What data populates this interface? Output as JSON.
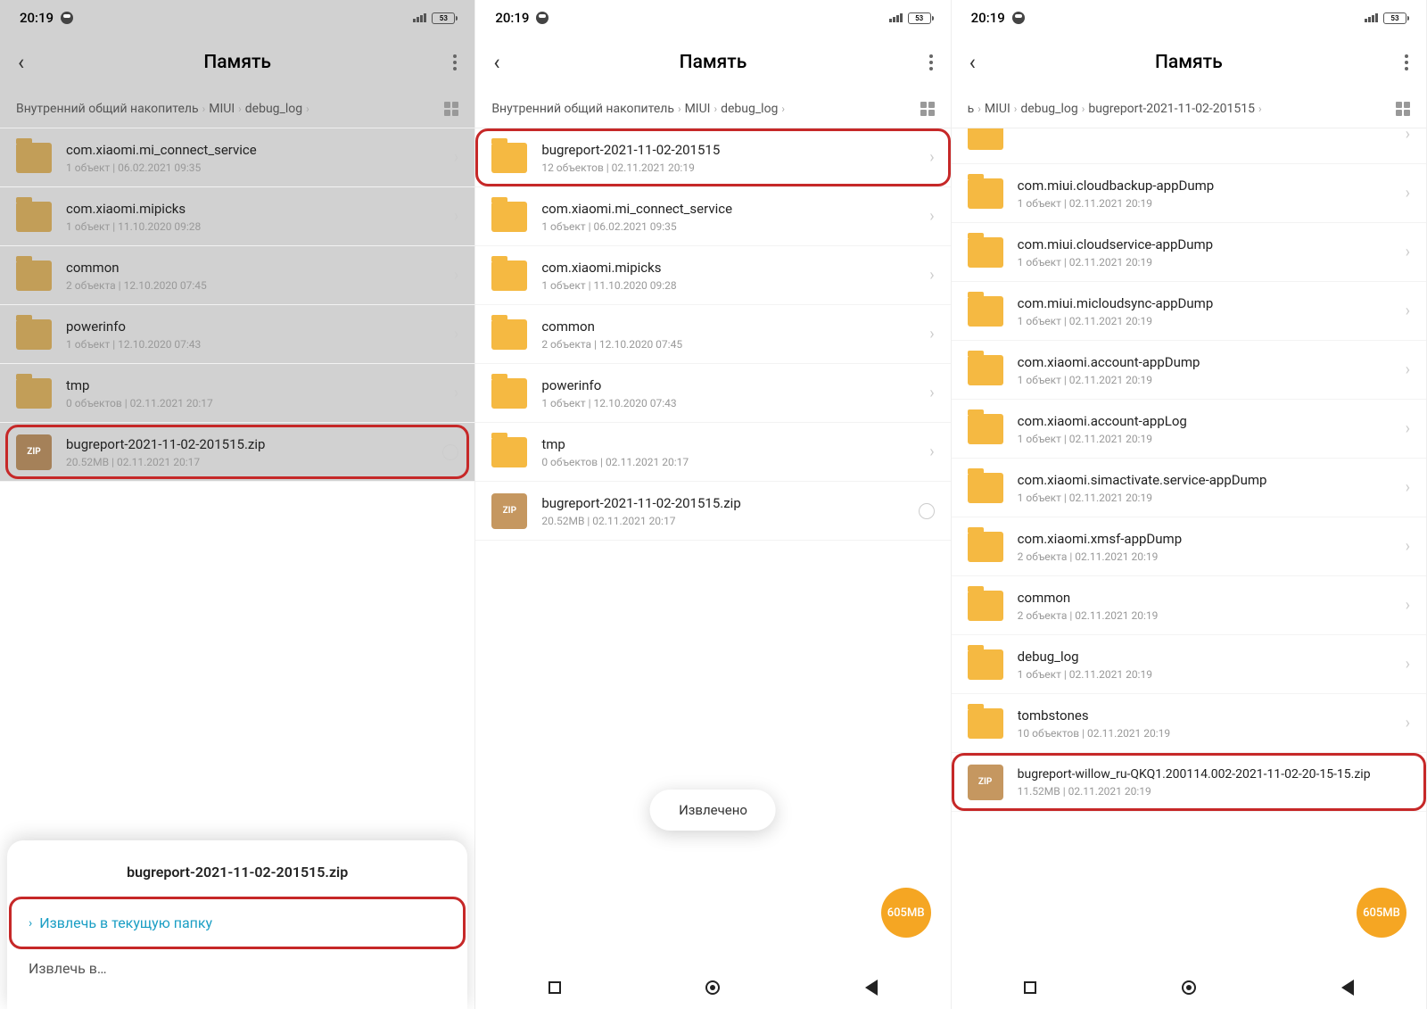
{
  "status": {
    "time": "20:19",
    "battery": "53"
  },
  "title": "Память",
  "bc_storage": "Внутренний общий накопитель",
  "bc_miui": "MIUI",
  "bc_debug": "debug_log",
  "bc_bug": "bugreport-2021-11-02-201515",
  "bc_short": "ь",
  "s1": {
    "items": [
      {
        "name": "com.xiaomi.mi_connect_service",
        "meta": "1 объект  |  06.02.2021 09:35"
      },
      {
        "name": "com.xiaomi.mipicks",
        "meta": "1 объект  |  11.10.2020 09:28"
      },
      {
        "name": "common",
        "meta": "2 объекта  |  12.10.2020 07:45"
      },
      {
        "name": "powerinfo",
        "meta": "1 объект  |  12.10.2020 07:43"
      },
      {
        "name": "tmp",
        "meta": "0 объектов  |  02.11.2021 20:17"
      }
    ],
    "zip": {
      "name": "bugreport-2021-11-02-201515.zip",
      "meta": "20.52MB  |  02.11.2021 20:17"
    },
    "sheet_title": "bugreport-2021-11-02-201515.zip",
    "extract_here": "Извлечь в текущую папку",
    "extract_to": "Извлечь в…"
  },
  "s2": {
    "items": [
      {
        "name": "bugreport-2021-11-02-201515",
        "meta": "12 объектов  |  02.11.2021 20:19"
      },
      {
        "name": "com.xiaomi.mi_connect_service",
        "meta": "1 объект  |  06.02.2021 09:35"
      },
      {
        "name": "com.xiaomi.mipicks",
        "meta": "1 объект  |  11.10.2020 09:28"
      },
      {
        "name": "common",
        "meta": "2 объекта  |  12.10.2020 07:45"
      },
      {
        "name": "powerinfo",
        "meta": "1 объект  |  12.10.2020 07:43"
      },
      {
        "name": "tmp",
        "meta": "0 объектов  |  02.11.2021 20:17"
      }
    ],
    "zip": {
      "name": "bugreport-2021-11-02-201515.zip",
      "meta": "20.52MB  |  02.11.2021 20:17"
    },
    "toast": "Извлечено",
    "fab": "605MB"
  },
  "s3": {
    "items": [
      {
        "name": "com.miui.cloudbackup-appDump",
        "meta": "1 объект  |  02.11.2021 20:19"
      },
      {
        "name": "com.miui.cloudservice-appDump",
        "meta": "1 объект  |  02.11.2021 20:19"
      },
      {
        "name": "com.miui.micloudsync-appDump",
        "meta": "1 объект  |  02.11.2021 20:19"
      },
      {
        "name": "com.xiaomi.account-appDump",
        "meta": "1 объект  |  02.11.2021 20:19"
      },
      {
        "name": "com.xiaomi.account-appLog",
        "meta": "1 объект  |  02.11.2021 20:19"
      },
      {
        "name": "com.xiaomi.simactivate.service-appDump",
        "meta": "1 объект  |  02.11.2021 20:19"
      },
      {
        "name": "com.xiaomi.xmsf-appDump",
        "meta": "2 объекта  |  02.11.2021 20:19"
      },
      {
        "name": "common",
        "meta": "2 объекта  |  02.11.2021 20:19"
      },
      {
        "name": "debug_log",
        "meta": "1 объект  |  02.11.2021 20:19"
      },
      {
        "name": "tombstones",
        "meta": "10 объектов  |  02.11.2021 20:19"
      }
    ],
    "zip": {
      "name": "bugreport-willow_ru-QKQ1.200114.002-2021-11-02-20-15-15.zip",
      "meta": "11.52MB  |  02.11.2021 20:19"
    },
    "fab": "605MB"
  },
  "zip_label": "ZIP"
}
